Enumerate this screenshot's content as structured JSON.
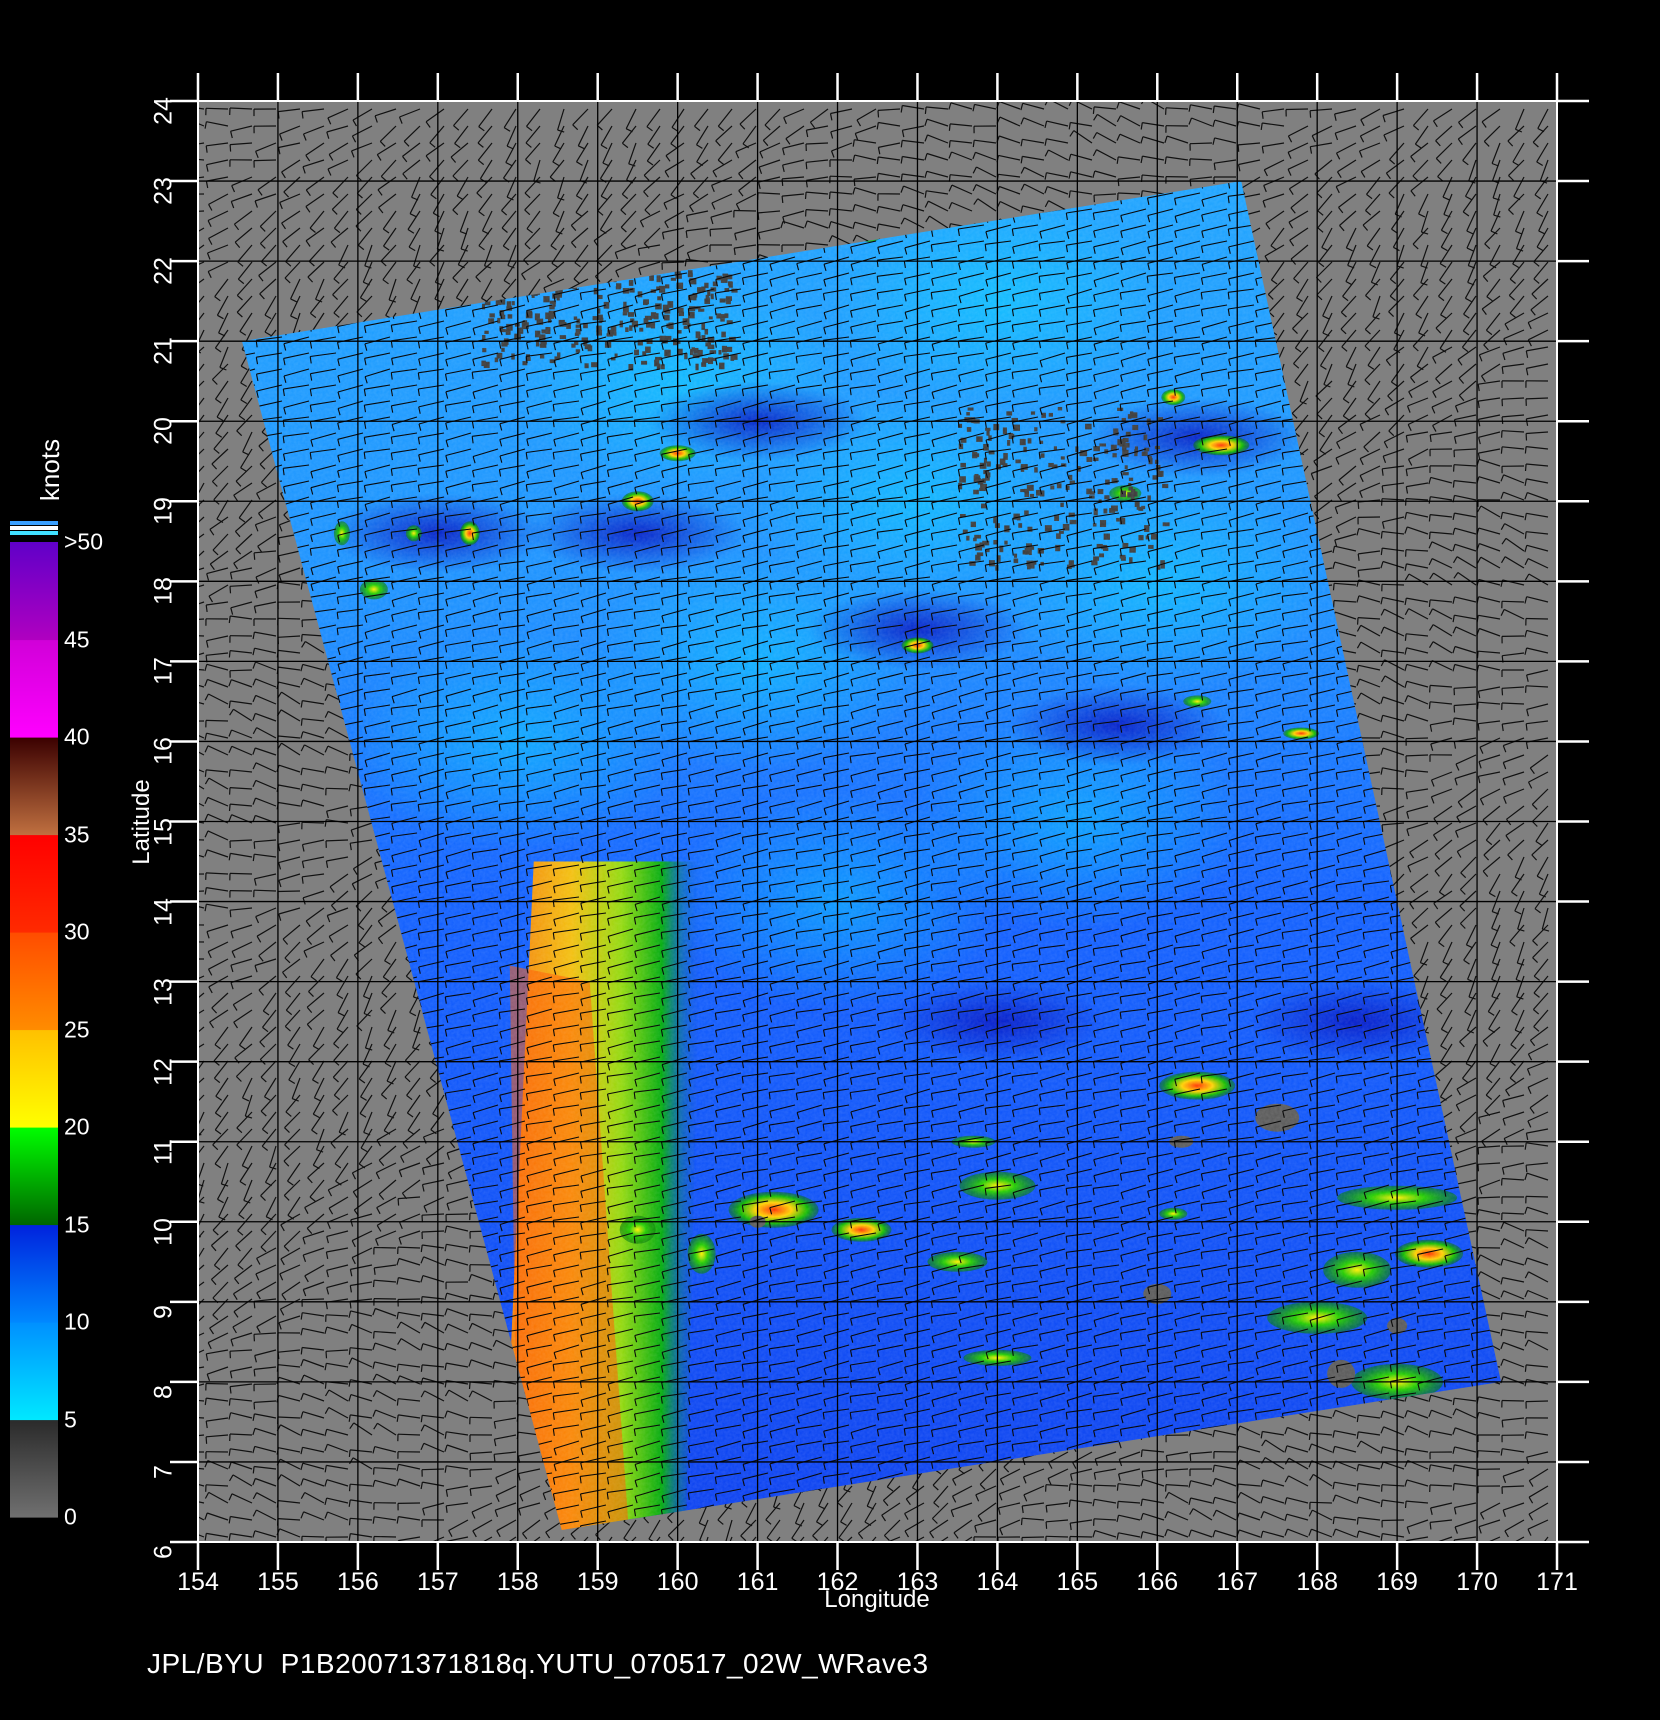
{
  "map": {
    "source": "JPL/BYU",
    "file_id": "P1B20071371818q.YUTU_070517_02W_WRave3",
    "x_axis_label": "Longitude",
    "y_axis_label": "Latitude",
    "lon_range": [
      154,
      171
    ],
    "lat_range": [
      6,
      24
    ],
    "x_ticks": [
      "154",
      "155",
      "156",
      "157",
      "158",
      "159",
      "160",
      "161",
      "162",
      "163",
      "164",
      "165",
      "166",
      "167",
      "168",
      "169",
      "170",
      "171"
    ],
    "y_ticks": [
      "6",
      "7",
      "8",
      "9",
      "10",
      "11",
      "12",
      "13",
      "14",
      "15",
      "16",
      "17",
      "18",
      "19",
      "20",
      "21",
      "22",
      "23",
      "24"
    ],
    "swath_corners_lonlat": [
      [
        154.55,
        21.0
      ],
      [
        167.05,
        23.0
      ],
      [
        170.3,
        8.0
      ],
      [
        158.55,
        6.15
      ]
    ],
    "background_color": "#000000",
    "land_no_data_color": "#808080",
    "axis_color": "#ffffff"
  },
  "colorbar": {
    "unit_label": "knots",
    "tick_labels": [
      "0",
      "5",
      "10",
      "15",
      "20",
      "25",
      "30",
      "35",
      "40",
      "45",
      ">50"
    ],
    "bands": [
      {
        "from": 0,
        "to": 5,
        "colors": [
          "#707070",
          "#2a2a2a"
        ]
      },
      {
        "from": 5,
        "to": 10,
        "colors": [
          "#00e8ff",
          "#0090ff"
        ]
      },
      {
        "from": 10,
        "to": 15,
        "colors": [
          "#0088ff",
          "#0022dd"
        ]
      },
      {
        "from": 15,
        "to": 20,
        "colors": [
          "#006600",
          "#00ff00"
        ]
      },
      {
        "from": 20,
        "to": 25,
        "colors": [
          "#ffff00",
          "#ffc000"
        ]
      },
      {
        "from": 25,
        "to": 30,
        "colors": [
          "#ff8c00",
          "#ff4c00"
        ]
      },
      {
        "from": 30,
        "to": 35,
        "colors": [
          "#ff2a00",
          "#ff0000"
        ]
      },
      {
        "from": 35,
        "to": 40,
        "colors": [
          "#c07040",
          "#3a0000"
        ]
      },
      {
        "from": 40,
        "to": 45,
        "colors": [
          "#ff00ff",
          "#d000d8"
        ]
      },
      {
        "from": 45,
        "to": 50,
        "colors": [
          "#b000c0",
          "#6000c8"
        ]
      }
    ],
    "over_colors": [
      "#3aa0ff",
      "#ffffff",
      "#40e0ff"
    ]
  }
}
